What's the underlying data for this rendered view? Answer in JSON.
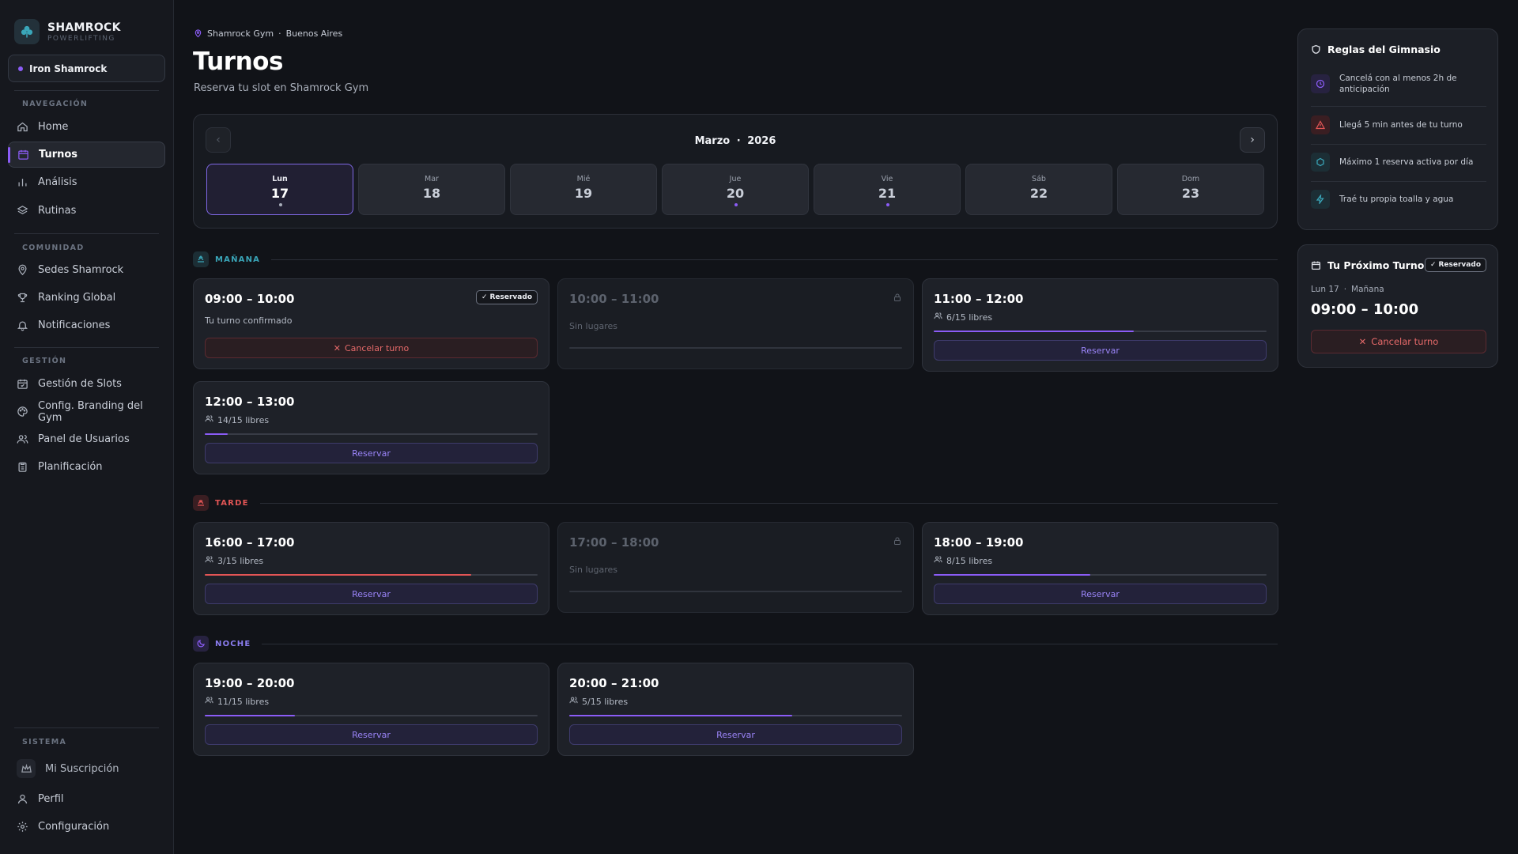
{
  "brand": {
    "name": "SHAMROCK",
    "tagline": "POWERLIFTING"
  },
  "gym_selector": {
    "label": "Iron Shamrock"
  },
  "nav": {
    "sections": {
      "navegacion": "NAVEGACIÓN",
      "comunidad": "COMUNIDAD",
      "gestion": "GESTIÓN",
      "sistema": "SISTEMA"
    },
    "items": {
      "home": "Home",
      "turnos": "Turnos",
      "analisis": "Análisis",
      "rutinas": "Rutinas",
      "sedes": "Sedes Shamrock",
      "ranking": "Ranking Global",
      "notificaciones": "Notificaciones",
      "slots": "Gestión de Slots",
      "branding": "Config. Branding del Gym",
      "usuarios": "Panel de Usuarios",
      "planificacion": "Planificación",
      "suscripcion": "Mi Suscripción",
      "perfil": "Perfil",
      "configuracion": "Configuración"
    }
  },
  "breadcrumb": {
    "gym": "Shamrock Gym",
    "separator": "·",
    "city": "Buenos Aires"
  },
  "page": {
    "title": "Turnos",
    "subtitle": "Reserva tu slot en Shamrock Gym"
  },
  "calendar": {
    "month": "Marzo",
    "separator": "·",
    "year": "2026",
    "days": [
      {
        "name": "Lun",
        "num": "17"
      },
      {
        "name": "Mar",
        "num": "18"
      },
      {
        "name": "Mié",
        "num": "19"
      },
      {
        "name": "Jue",
        "num": "20"
      },
      {
        "name": "Vie",
        "num": "21"
      },
      {
        "name": "Sáb",
        "num": "22"
      },
      {
        "name": "Dom",
        "num": "23"
      }
    ]
  },
  "periods": {
    "manana": "MAÑANA",
    "tarde": "TARDE",
    "noche": "NOCHE"
  },
  "slots": {
    "m1": {
      "time": "09:00 – 10:00",
      "sub": "Tu turno confirmado",
      "badge": "Reservado",
      "button": "Cancelar turno"
    },
    "m2": {
      "time": "10:00 – 11:00",
      "sub": "Sin lugares"
    },
    "m3": {
      "time": "11:00 – 12:00",
      "sub": "6/15 libres",
      "button": "Reservar",
      "fill": 0.6
    },
    "m4": {
      "time": "12:00 – 13:00",
      "sub": "14/15 libres",
      "button": "Reservar",
      "fill": 0.07
    },
    "t1": {
      "time": "16:00 – 17:00",
      "sub": "3/15 libres",
      "button": "Reservar",
      "fill": 0.8
    },
    "t2": {
      "time": "17:00 – 18:00",
      "sub": "Sin lugares"
    },
    "t3": {
      "time": "18:00 – 19:00",
      "sub": "8/15 libres",
      "button": "Reservar",
      "fill": 0.47
    },
    "n1": {
      "time": "19:00 – 20:00",
      "sub": "11/15 libres",
      "button": "Reservar",
      "fill": 0.27
    },
    "n2": {
      "time": "20:00 – 21:00",
      "sub": "5/15 libres",
      "button": "Reservar",
      "fill": 0.67
    }
  },
  "rules": {
    "title": "Reglas del Gimnasio",
    "items": [
      "Cancelá con al menos 2h de anticipación",
      "Llegá 5 min antes de tu turno",
      "Máximo 1 reserva activa por día",
      "Traé tu propia toalla y agua"
    ]
  },
  "next_turn": {
    "title": "Tu Próximo Turno",
    "badge": "Reservado",
    "day": "Lun 17",
    "separator": "·",
    "period": "Mañana",
    "time": "09:00 – 10:00",
    "cancel": "Cancelar turno"
  },
  "colors": {
    "accent": "#8b5cf6",
    "danger": "#e25555",
    "teal": "#3aa6b9",
    "background": "#111318"
  }
}
